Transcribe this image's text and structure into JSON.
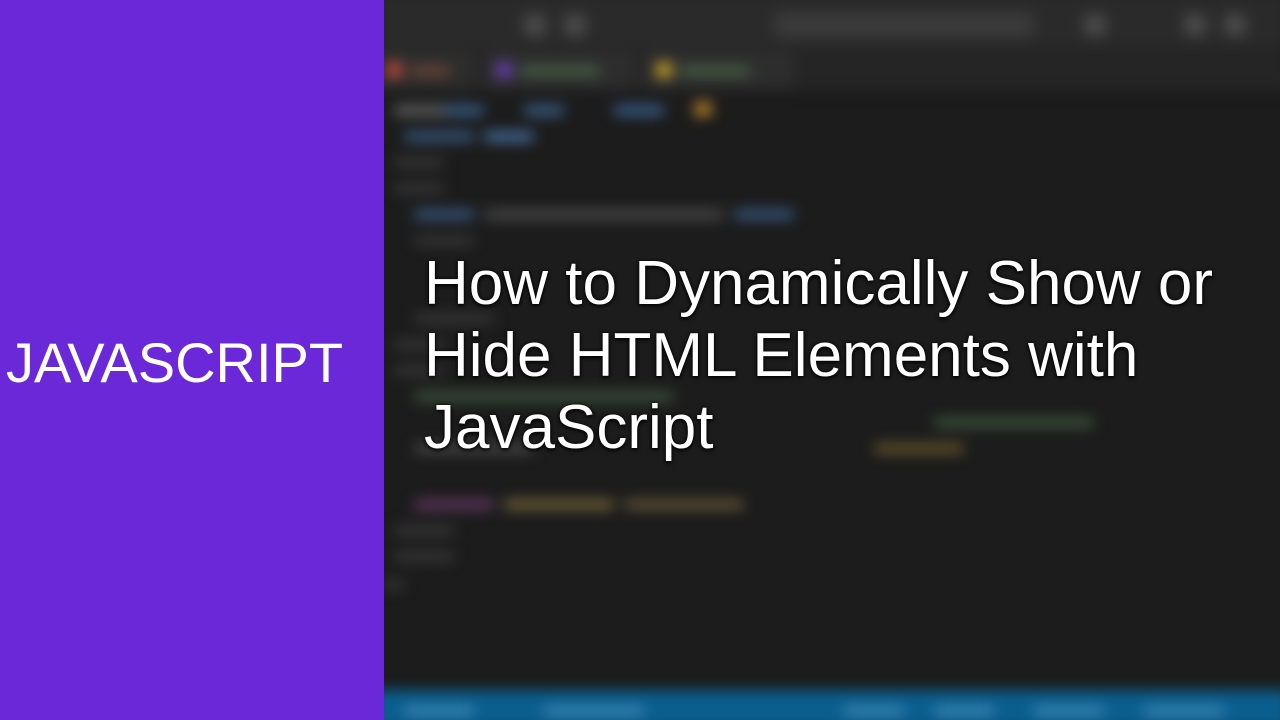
{
  "category": {
    "label": "JAVASCRIPT",
    "color": "#6b28d9"
  },
  "headline": {
    "text": "How to Dynamically Show or Hide HTML Elements with JavaScript",
    "color": "#ffffff"
  },
  "background": {
    "description_kind": "blurred-code-editor",
    "editor_bg_color": "#1c1c1c",
    "statusbar_color": "#0a5e8e"
  }
}
